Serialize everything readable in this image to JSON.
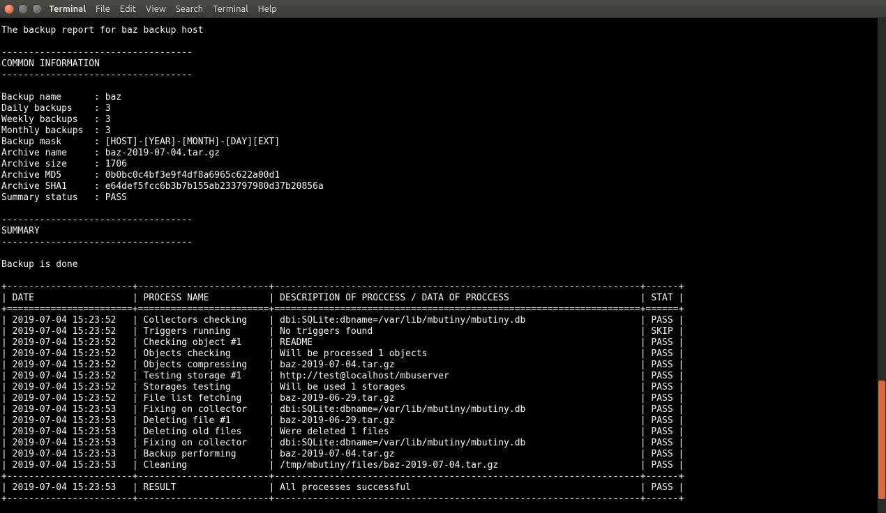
{
  "window": {
    "app_title": "Terminal",
    "menu": [
      "File",
      "Edit",
      "View",
      "Search",
      "Terminal",
      "Help"
    ]
  },
  "report": {
    "title_line": "The backup report for baz backup host",
    "section_divider": "-----------------------------------",
    "common_info_header": "COMMON INFORMATION",
    "fields": [
      {
        "label": "Backup name",
        "value": "baz"
      },
      {
        "label": "Daily backups",
        "value": "3"
      },
      {
        "label": "Weekly backups",
        "value": "3"
      },
      {
        "label": "Monthly backups",
        "value": "3"
      },
      {
        "label": "Backup mask",
        "value": "[HOST]-[YEAR]-[MONTH]-[DAY][EXT]"
      },
      {
        "label": "Archive name",
        "value": "baz-2019-07-04.tar.gz"
      },
      {
        "label": "Archive size",
        "value": "1706"
      },
      {
        "label": "Archive MD5",
        "value": "0b0bc0c4bf3e9f4df8a6965c622a00d1"
      },
      {
        "label": "Archive SHA1",
        "value": "e64def5fcc6b3b7b155ab233797980d37b20856a"
      },
      {
        "label": "Summary status",
        "value": "PASS"
      }
    ],
    "summary_header": "SUMMARY",
    "summary_body": "Backup is done",
    "table": {
      "columns": [
        "DATE",
        "PROCESS NAME",
        "DESCRIPTION OF PROCCESS / DATA OF PROCCESS",
        "STAT"
      ],
      "rows": [
        [
          "2019-07-04 15:23:52",
          "Collectors checking",
          "dbi:SQLite:dbname=/var/lib/mbutiny/mbutiny.db",
          "PASS"
        ],
        [
          "2019-07-04 15:23:52",
          "Triggers running",
          "No triggers found",
          "SKIP"
        ],
        [
          "2019-07-04 15:23:52",
          "Checking object #1",
          "README",
          "PASS"
        ],
        [
          "2019-07-04 15:23:52",
          "Objects checking",
          "Will be processed 1 objects",
          "PASS"
        ],
        [
          "2019-07-04 15:23:52",
          "Objects compressing",
          "baz-2019-07-04.tar.gz",
          "PASS"
        ],
        [
          "2019-07-04 15:23:52",
          "Testing storage #1",
          "http://test@localhost/mbuserver",
          "PASS"
        ],
        [
          "2019-07-04 15:23:52",
          "Storages testing",
          "Will be used 1 storages",
          "PASS"
        ],
        [
          "2019-07-04 15:23:52",
          "File list fetching",
          "baz-2019-06-29.tar.gz",
          "PASS"
        ],
        [
          "2019-07-04 15:23:53",
          "Fixing on collector",
          "dbi:SQLite:dbname=/var/lib/mbutiny/mbutiny.db",
          "PASS"
        ],
        [
          "2019-07-04 15:23:53",
          "Deleting file #1",
          "baz-2019-06-29.tar.gz",
          "PASS"
        ],
        [
          "2019-07-04 15:23:53",
          "Deleting old files",
          "Were deleted 1 files",
          "PASS"
        ],
        [
          "2019-07-04 15:23:53",
          "Fixing on collector",
          "dbi:SQLite:dbname=/var/lib/mbutiny/mbutiny.db",
          "PASS"
        ],
        [
          "2019-07-04 15:23:53",
          "Backup performing",
          "baz-2019-07-04.tar.gz",
          "PASS"
        ],
        [
          "2019-07-04 15:23:53",
          "Cleaning",
          "/tmp/mbutiny/files/baz-2019-07-04.tar.gz",
          "PASS"
        ]
      ],
      "footer": [
        "2019-07-04 15:23:53",
        "RESULT",
        "All processes successful",
        "PASS"
      ]
    }
  }
}
